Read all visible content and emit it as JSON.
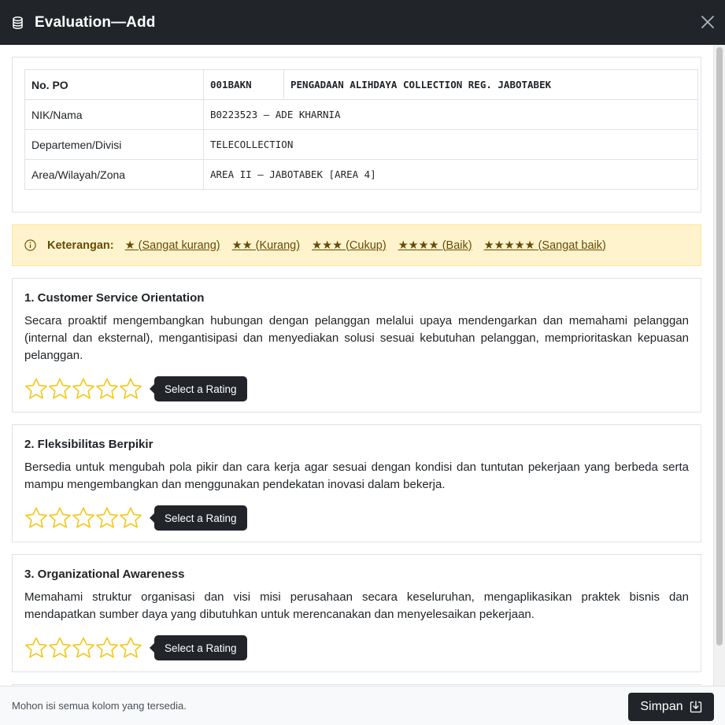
{
  "header": {
    "title": "Evaluation—Add",
    "icon": "database-icon",
    "close_icon": "close-icon"
  },
  "info_table": {
    "po_label": "No. PO",
    "po_code": "001BAKN",
    "po_name": "PENGADAAN ALIHDAYA COLLECTION REG. JABOTABEK",
    "rows": [
      {
        "label": "NIK/Nama",
        "value": "B0223523 — ADE KHARNIA"
      },
      {
        "label": "Departemen/Divisi",
        "value": "TELECOLLECTION"
      },
      {
        "label": "Area/Wilayah/Zona",
        "value": "AREA II — JABOTABEK [AREA 4]"
      }
    ]
  },
  "legend": {
    "icon": "info-circle-icon",
    "title": "Keterangan:",
    "items": [
      "★ (Sangat kurang)",
      "★★ (Kurang)",
      "★★★ (Cukup)",
      "★★★★ (Baik)",
      "★★★★★ (Sangat baik)"
    ]
  },
  "questions": [
    {
      "title": "1. Customer Service Orientation",
      "description": "Secara proaktif mengembangkan hubungan dengan pelanggan melalui upaya mendengarkan dan memahami pelanggan (internal dan eksternal), mengantisipasi dan menyediakan solusi sesuai kebutuhan pelanggan, memprioritaskan kepuasan pelanggan.",
      "rating": 0,
      "tooltip": "Select a Rating"
    },
    {
      "title": "2. Fleksibilitas Berpikir",
      "description": "Bersedia untuk mengubah pola pikir dan cara kerja agar sesuai dengan kondisi dan tuntutan pekerjaan yang berbeda serta mampu mengembangkan dan menggunakan pendekatan inovasi dalam bekerja.",
      "rating": 0,
      "tooltip": "Select a Rating"
    },
    {
      "title": "3. Organizational Awareness",
      "description": "Memahami struktur organisasi dan visi misi perusahaan secara keseluruhan, mengaplikasikan praktek bisnis dan mendapatkan sumber daya yang dibutuhkan untuk merencanakan dan menyelesaikan pekerjaan.",
      "rating": 0,
      "tooltip": "Select a Rating"
    }
  ],
  "colors": {
    "header_bg": "#212529",
    "star": "#f5c518",
    "legend_bg": "#fff3cd",
    "legend_text": "#664d03"
  },
  "footer": {
    "note": "Mohon isi semua kolom yang tersedia.",
    "save_label": "Simpan",
    "save_icon": "download-box-icon"
  }
}
